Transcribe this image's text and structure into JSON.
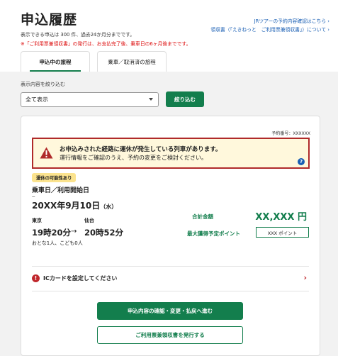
{
  "page": {
    "title": "申込履歴",
    "info_text": "表示できる申込は 300 件、過去24か月分までです。",
    "note_text": "※「ご利用票兼領収書」の発行は、お支払完了後、乗車日の6ヶ月後までです。",
    "link_tour": "JRツアーの予約内容確認はこちら ›",
    "link_receipt": "領収書（「えきねっと　ご利用票兼領収書」）について ›"
  },
  "tabs": [
    {
      "label": "申込中の旅程",
      "active": true
    },
    {
      "label": "乗車／取消済の旅程",
      "active": false
    }
  ],
  "filter": {
    "label": "表示内容を絞り込む",
    "selected": "全て表示",
    "button": "絞り込む"
  },
  "reservation": {
    "number_text": "予約番号：XXXXXX",
    "alert_line1": "お申込みされた経路に運休が発生している列車があります。",
    "alert_line2": "運行情報をご確認のうえ、予約の変更をご検討ください。",
    "help_glyph": "?",
    "badge": "運休の可能性あり",
    "date_label": "乗車日／利用開始日",
    "date_dash": "---",
    "date_main": "20XX年9月10日",
    "date_dow": "（水）",
    "from_station": "東京",
    "to_station": "仙台",
    "dep_time": "19時20分",
    "arr_time": "20時52分",
    "arrow": "→",
    "passengers": "おとな1人、こども0人",
    "total_label": "合計金額",
    "total_value": "XX,XXX 円",
    "points_label": "最大獲得予定ポイント",
    "points_value": "XXX ポイント",
    "ic_glyph": "!",
    "ic_text": "ICカードを設定してください",
    "ic_chevron": "›",
    "btn_confirm": "申込内容の確認・変更・払戻へ進む",
    "btn_receipt": "ご利用票兼領収書を発行する"
  },
  "colors": {
    "brand_green": "#137e4d",
    "alert_red": "#b02a2a",
    "alert_bg": "#fff8dc",
    "badge_yellow": "#fbe38e",
    "link_blue": "#1a5fb4"
  }
}
